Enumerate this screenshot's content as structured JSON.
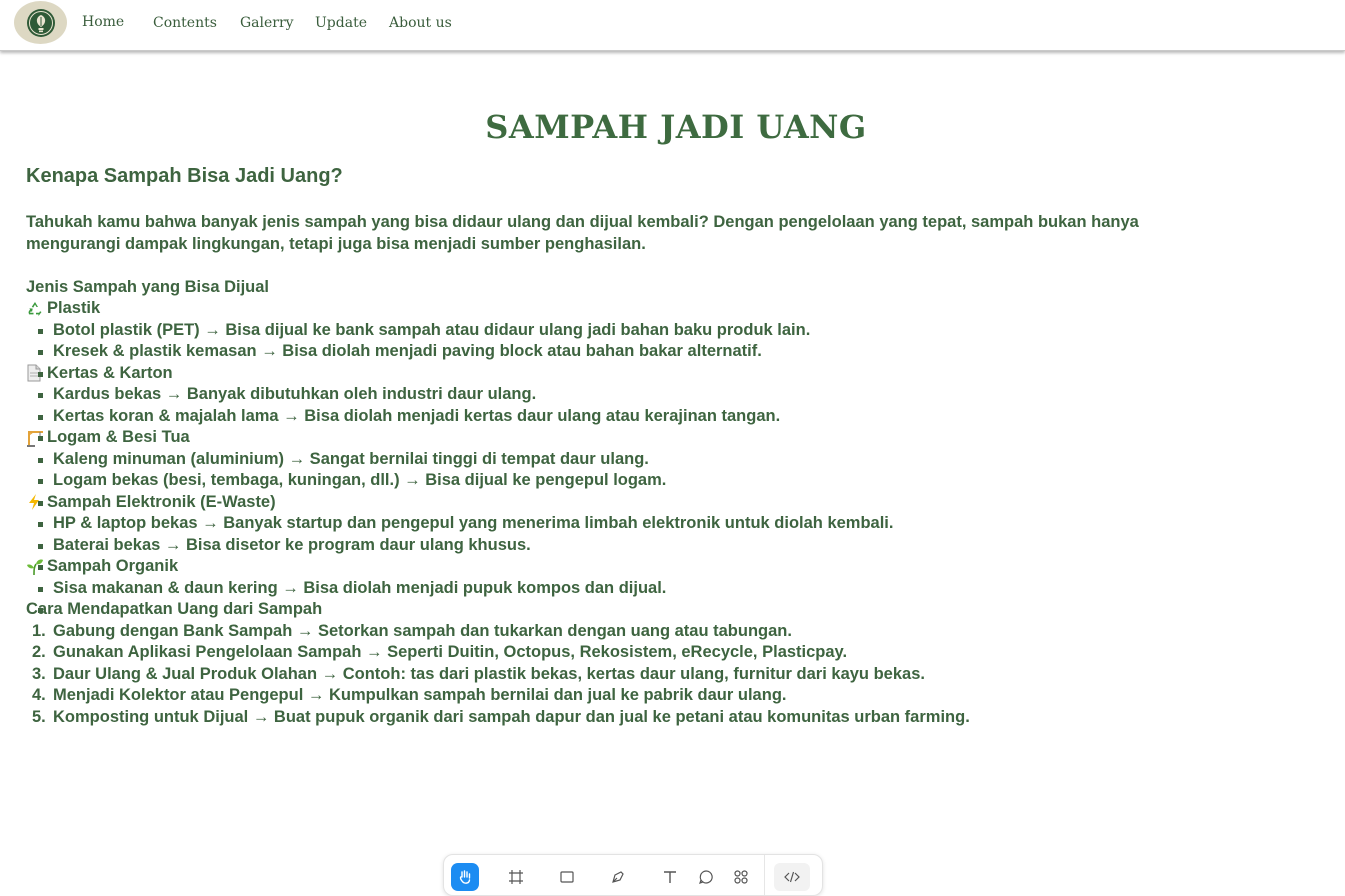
{
  "nav": {
    "logo_icon": "leaf-bulb-logo",
    "links": [
      "Home",
      "Contents",
      "Galerry",
      "Update",
      "About us"
    ]
  },
  "page": {
    "title": "SAMPAH JADI UANG",
    "subtitle": "Kenapa Sampah Bisa Jadi Uang?",
    "intro": "Tahukah kamu bahwa banyak jenis sampah yang bisa didaur ulang dan dijual kembali? Dengan pengelolaan yang tepat, sampah bukan hanya mengurangi dampak lingkungan, tetapi juga bisa menjadi sumber penghasilan."
  },
  "jenis": {
    "heading": "Jenis Sampah yang Bisa Dijual",
    "categories": [
      {
        "icon": "recycle-icon",
        "title": "Plastik",
        "items": [
          "Botol plastik (PET) → Bisa dijual ke bank sampah atau didaur ulang jadi bahan baku produk lain.",
          "Kresek & plastik kemasan → Bisa diolah menjadi paving block atau bahan bakar alternatif."
        ]
      },
      {
        "icon": "page-icon",
        "title": "Kertas & Karton",
        "items": [
          "Kardus bekas → Banyak dibutuhkan oleh industri daur ulang.",
          "Kertas koran & majalah lama → Bisa diolah menjadi kertas daur ulang atau kerajinan tangan."
        ]
      },
      {
        "icon": "crane-icon",
        "title": "Logam & Besi Tua",
        "items": [
          "Kaleng minuman (aluminium) → Sangat bernilai tinggi di tempat daur ulang.",
          "Logam bekas (besi, tembaga, kuningan, dll.) → Bisa dijual ke pengepul logam."
        ]
      },
      {
        "icon": "lightning-icon",
        "title": "Sampah Elektronik (E-Waste)",
        "items": [
          "HP & laptop bekas → Banyak startup dan pengepul yang menerima limbah elektronik untuk diolah kembali.",
          "Baterai bekas → Bisa disetor ke program daur ulang khusus."
        ]
      },
      {
        "icon": "seedling-icon",
        "title": "Sampah Organik",
        "items": [
          "Sisa makanan & daun kering → Bisa diolah menjadi pupuk kompos dan dijual."
        ]
      }
    ]
  },
  "cara": {
    "heading": "Cara Mendapatkan Uang dari Sampah",
    "steps": [
      "Gabung dengan Bank Sampah → Setorkan sampah dan tukarkan dengan uang atau tabungan.",
      "Gunakan Aplikasi Pengelolaan Sampah → Seperti Duitin, Octopus, Rekosistem, eRecycle, Plasticpay.",
      "Daur Ulang & Jual Produk Olahan → Contoh: tas dari plastik bekas, kertas daur ulang, furnitur dari kayu bekas.",
      "Menjadi Kolektor atau Pengepul → Kumpulkan sampah bernilai dan jual ke pabrik daur ulang.",
      "Komposting untuk Dijual → Buat pupuk organik dari sampah dapur dan jual ke petani atau komunitas urban farming."
    ]
  },
  "toolbar": {
    "tools": [
      "hand-tool-icon",
      "frame-tool-icon",
      "rectangle-tool-icon",
      "pen-tool-icon",
      "text-tool-icon",
      "comment-tool-icon",
      "components-tool-icon",
      "code-view-icon"
    ],
    "active": "hand-tool-icon",
    "accent": "#1c8cf2"
  },
  "colors": {
    "text": "#3e6440",
    "title": "#3e6b40",
    "logo_bg": "#ddd8c3"
  }
}
